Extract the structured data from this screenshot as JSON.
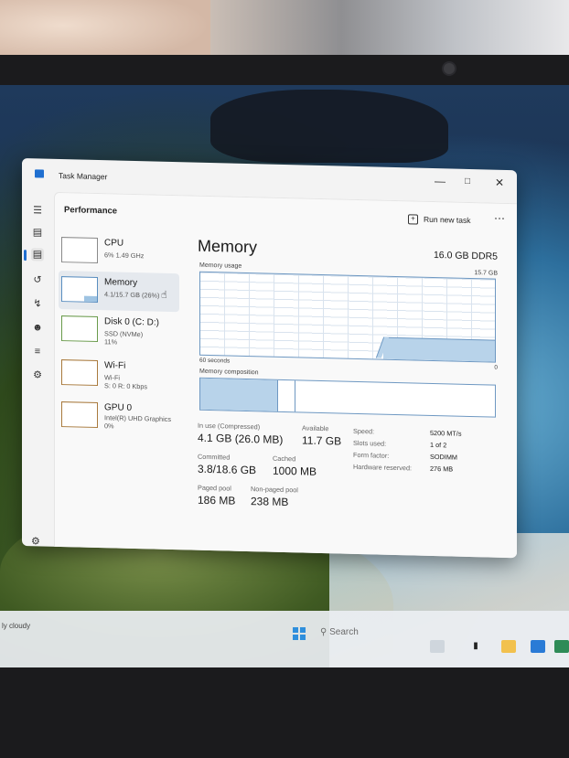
{
  "window": {
    "title": "Task Manager"
  },
  "header": {
    "section_title": "Performance",
    "run_new_task": "Run new task",
    "more": "⋯"
  },
  "devices": [
    {
      "name": "CPU",
      "line1": "6% 1.49 GHz",
      "line2": ""
    },
    {
      "name": "Memory",
      "line1": "4.1/15.7 GB (26%)",
      "line2": ""
    },
    {
      "name": "Disk 0 (C: D:)",
      "line1": "SSD (NVMe)",
      "line2": "11%"
    },
    {
      "name": "Wi-Fi",
      "line1": "Wi-Fi",
      "line2": "S: 0 R: 0 Kbps"
    },
    {
      "name": "GPU 0",
      "line1": "Intel(R) UHD Graphics",
      "line2": "0%"
    }
  ],
  "memory": {
    "title": "Memory",
    "spec": "16.0 GB DDR5",
    "usage_label": "Memory usage",
    "usage_max": "15.7 GB",
    "usage_fraction": 0.26,
    "axis_left": "60 seconds",
    "axis_right": "0",
    "composition_label": "Memory composition",
    "composition": {
      "in_use_fraction": 0.26,
      "modified_fraction": 0.06
    },
    "stats": {
      "in_use_label": "In use (Compressed)",
      "in_use_value": "4.1 GB (26.0 MB)",
      "available_label": "Available",
      "available_value": "11.7 GB",
      "committed_label": "Committed",
      "committed_value": "3.8/18.6 GB",
      "cached_label": "Cached",
      "cached_value": "1000 MB",
      "paged_label": "Paged pool",
      "paged_value": "186 MB",
      "nonpaged_label": "Non-paged pool",
      "nonpaged_value": "238 MB"
    },
    "details": {
      "speed_label": "Speed:",
      "speed_value": "5200 MT/s",
      "slots_label": "Slots used:",
      "slots_value": "1 of 2",
      "form_label": "Form factor:",
      "form_value": "SODIMM",
      "reserved_label": "Hardware reserved:",
      "reserved_value": "276 MB"
    }
  },
  "taskbar": {
    "weather": "ly cloudy",
    "search_placeholder": "Search"
  },
  "colors": {
    "accent": "#1f6fd0",
    "memory_fill": "#b8d3ea",
    "memory_border": "#6e98c2"
  }
}
